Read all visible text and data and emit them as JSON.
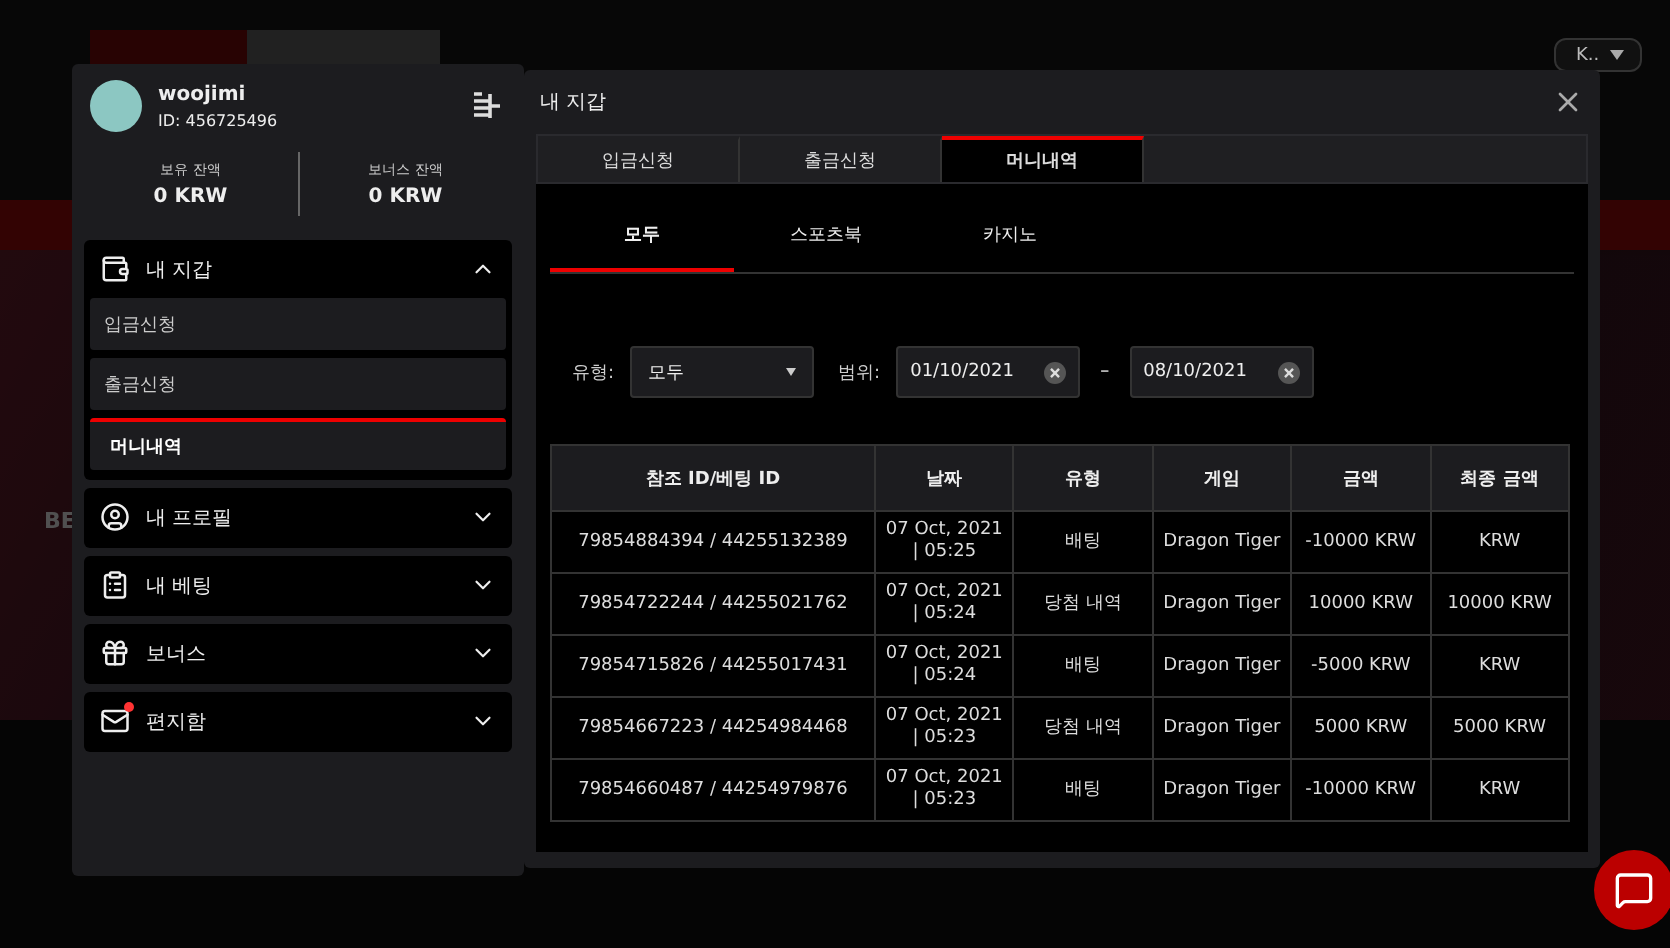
{
  "site": {
    "language": "K..",
    "hero_text": "BE"
  },
  "profile": {
    "username": "woojimi",
    "user_id": "ID: 456725496",
    "balances": [
      {
        "label": "보유 잔액",
        "value": "0 KRW"
      },
      {
        "label": "보너스 잔액",
        "value": "0 KRW"
      }
    ]
  },
  "sidebar": {
    "sections": [
      {
        "kind": "wallet",
        "label": "내 지갑",
        "expanded": true,
        "children": [
          {
            "label": "입금신청",
            "selected": false
          },
          {
            "label": "출금신청",
            "selected": false
          },
          {
            "label": "머니내역",
            "selected": true
          }
        ]
      },
      {
        "kind": "profile",
        "label": "내 프로필",
        "expanded": false
      },
      {
        "kind": "bets",
        "label": "내 베팅",
        "expanded": false
      },
      {
        "kind": "bonus",
        "label": "보너스",
        "expanded": false
      },
      {
        "kind": "mail",
        "label": "편지함",
        "expanded": false,
        "unread": true
      }
    ]
  },
  "panel": {
    "title": "내 지갑",
    "tabs": [
      {
        "label": "입금신청",
        "selected": false
      },
      {
        "label": "출금신청",
        "selected": false
      },
      {
        "label": "머니내역",
        "selected": true
      }
    ],
    "subtabs": [
      {
        "label": "모두",
        "selected": true
      },
      {
        "label": "스포츠북",
        "selected": false
      },
      {
        "label": "카지노",
        "selected": false
      }
    ],
    "filters": {
      "type_label": "유형:",
      "type_value": "모두",
      "range_label": "범위:",
      "date_from": "01/10/2021",
      "separator": "–",
      "date_to": "08/10/2021"
    },
    "table": {
      "columns": [
        "참조 ID/베팅 ID",
        "날짜",
        "유형",
        "게임",
        "금액",
        "최종 금액"
      ],
      "rows": [
        [
          "79854884394 / 44255132389",
          "07 Oct, 2021\n| 05:25",
          "배팅",
          "Dragon Tiger",
          "-10000 KRW",
          "KRW"
        ],
        [
          "79854722244 / 44255021762",
          "07 Oct, 2021\n| 05:24",
          "당첨 내역",
          "Dragon Tiger",
          "10000 KRW",
          "10000 KRW"
        ],
        [
          "79854715826 / 44255017431",
          "07 Oct, 2021\n| 05:24",
          "배팅",
          "Dragon Tiger",
          "-5000 KRW",
          "KRW"
        ],
        [
          "79854667223 / 44254984468",
          "07 Oct, 2021\n| 05:23",
          "당첨 내역",
          "Dragon Tiger",
          "5000 KRW",
          "5000 KRW"
        ],
        [
          "79854660487 / 44254979876",
          "07 Oct, 2021\n| 05:23",
          "배팅",
          "Dragon Tiger",
          "-10000 KRW",
          "KRW"
        ]
      ]
    }
  }
}
